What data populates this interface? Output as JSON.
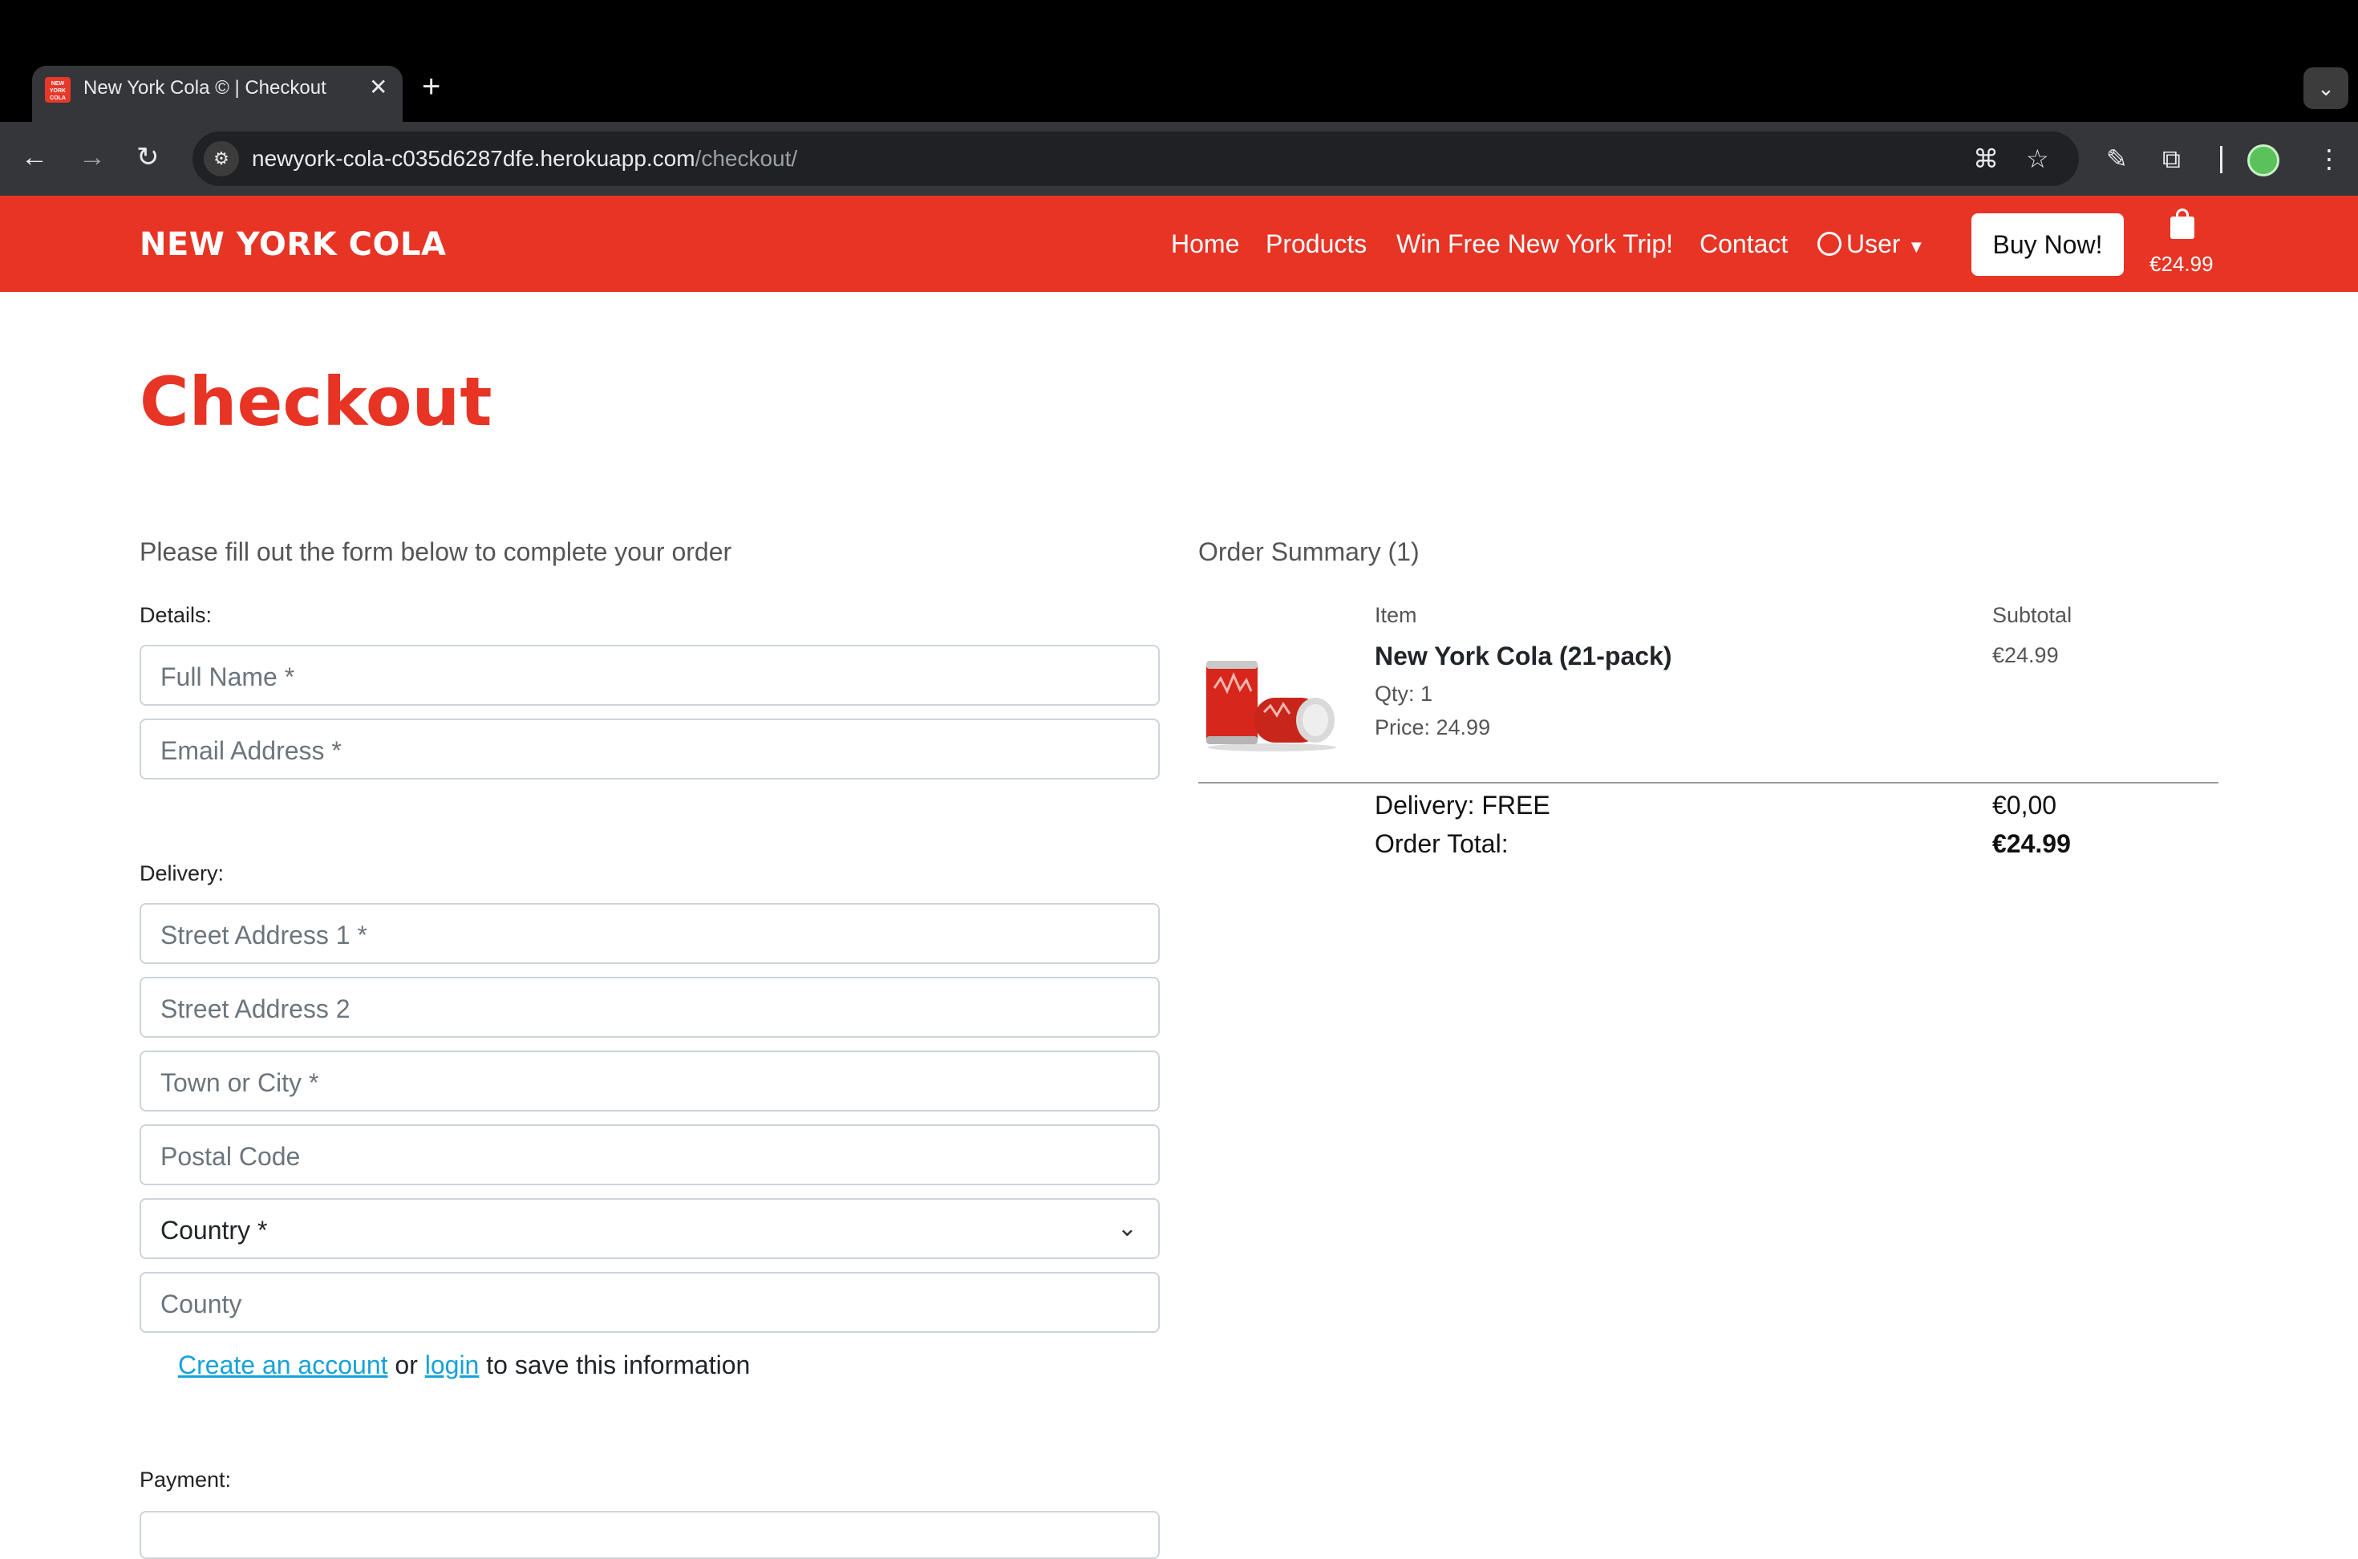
{
  "browser": {
    "tab_title": "New York Cola © | Checkout",
    "favicon_text": "NEW YORK COLA",
    "url_host": "newyork-cola-c035d6287dfe.herokuapp.com",
    "url_path": "/checkout/"
  },
  "navbar": {
    "brand": "NEW YORK COLA",
    "links": [
      "Home",
      "Products",
      "Win Free New York Trip!",
      "Contact"
    ],
    "user_label": "User",
    "buy_button": "Buy Now!",
    "cart_total": "€24.99"
  },
  "page": {
    "title": "Checkout",
    "lead": "Please fill out the form below to complete your order"
  },
  "form": {
    "details_label": "Details:",
    "full_name_placeholder": "Full Name *",
    "email_placeholder": "Email Address *",
    "delivery_label": "Delivery:",
    "street1_placeholder": "Street Address 1 *",
    "street2_placeholder": "Street Address 2",
    "town_placeholder": "Town or City *",
    "postal_placeholder": "Postal Code",
    "country_value": "Country *",
    "county_placeholder": "County",
    "save_prefix": "",
    "create_account_link": "Create an account",
    "or_text": "or",
    "login_link": "login",
    "save_suffix": "to save this information",
    "payment_label": "Payment:"
  },
  "summary": {
    "title": "Order Summary (1)",
    "item_header": "Item",
    "subtotal_header": "Subtotal",
    "product_name": "New York Cola (21-pack)",
    "qty": "Qty: 1",
    "price": "Price: 24.99",
    "subtotal": "€24.99",
    "delivery_label": "Delivery: FREE",
    "delivery_value": "€0,00",
    "total_label": "Order Total:",
    "total_value": "€24.99"
  },
  "colors": {
    "brand_red": "#e73425",
    "link_blue": "#17a2d8"
  }
}
